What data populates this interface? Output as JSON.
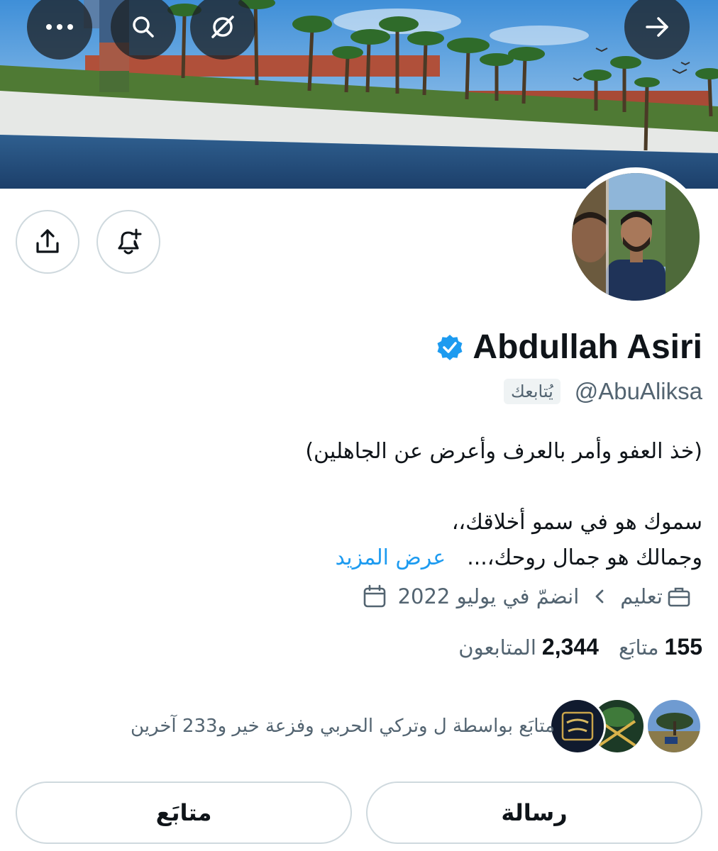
{
  "profile": {
    "name": "Abdullah Asiri",
    "handle": "@AbuAliksa",
    "follows_you_badge": "يُتابعك",
    "verified": true,
    "bio_line1": "(خذ العفو وأمر بالعرف وأعرض عن الجاهلين)",
    "bio_line2": "سموك هو في سمو أخلاقك،،",
    "bio_line3": "وجمالك هو جمال روحك،...",
    "show_more": "عرض المزيد",
    "category": "تعليم",
    "joined": "انضمّ في يوليو 2022",
    "following_count": "155",
    "following_label": "متابَع",
    "followers_count": "2,344",
    "followers_label": "المتابعون",
    "followed_by_text": "متابَع بواسطة ل وتركي الحربي وفزعة خير و233 آخرين"
  },
  "actions": {
    "message_label": "رسالة",
    "following_label": "متابَع"
  },
  "icons": {
    "more": "more-horizontal-icon",
    "search": "search-icon",
    "grok": "grok-icon",
    "back": "arrow-right-icon",
    "share": "share-icon",
    "notify": "bell-plus-icon",
    "verified": "verified-badge-icon",
    "category": "briefcase-icon",
    "calendar": "calendar-icon",
    "chevron": "chevron-left-icon"
  },
  "colors": {
    "accent": "#1d9bf0",
    "text_primary": "#0f1419",
    "text_secondary": "#536471",
    "border": "#cfd9de"
  }
}
